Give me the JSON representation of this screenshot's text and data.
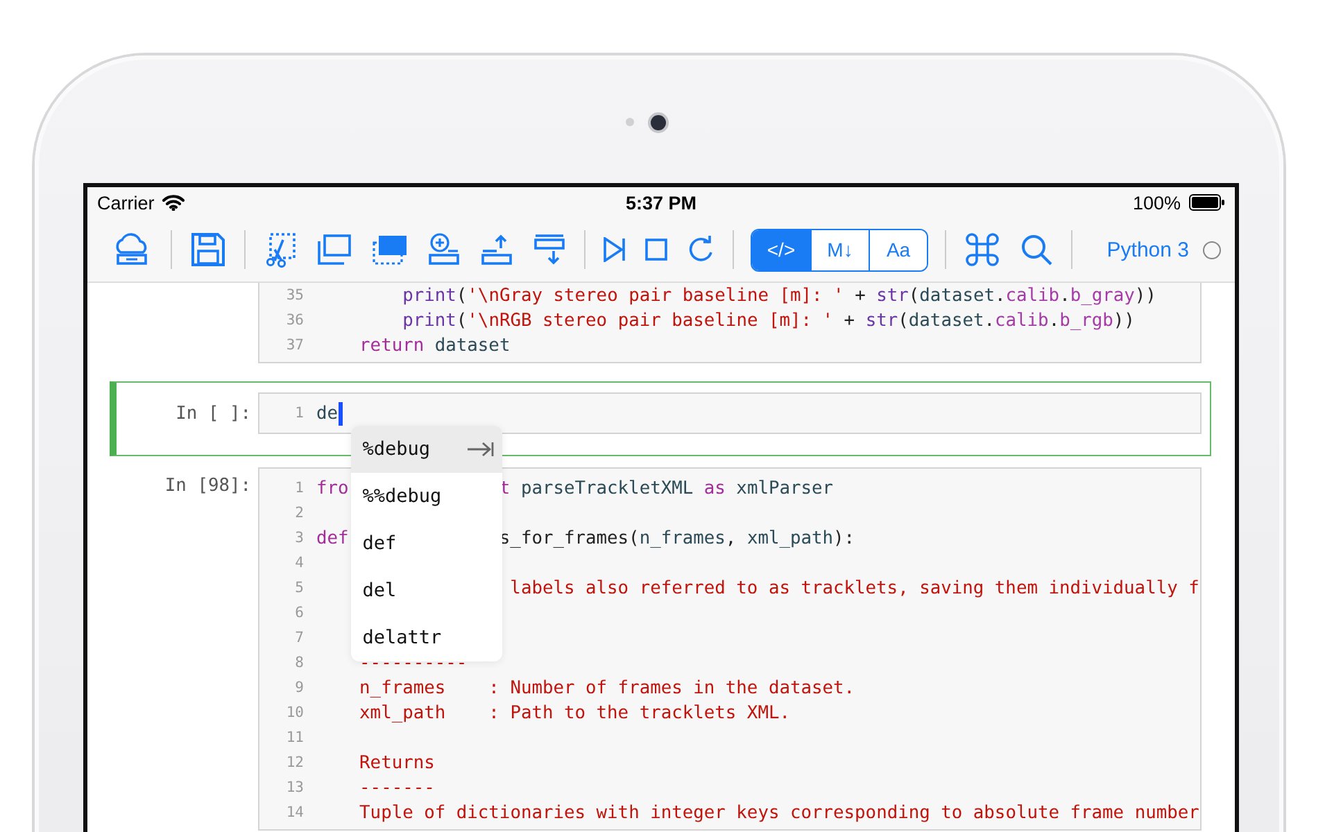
{
  "status_bar": {
    "carrier": "Carrier",
    "time": "5:37 PM",
    "battery": "100%"
  },
  "toolbar": {
    "modes": [
      {
        "label": "</>",
        "selected": true
      },
      {
        "label": "M↓",
        "selected": false
      },
      {
        "label": "Aa",
        "selected": false
      }
    ],
    "kernel": {
      "name": "Python 3",
      "busy": false
    }
  },
  "cells": [
    {
      "selected": false,
      "lines": [
        {
          "n": "35",
          "tokens": [
            {
              "t": "        print",
              "kind": "builtin"
            },
            {
              "t": "(",
              "kind": "plain"
            },
            {
              "t": "'\\nGray stereo pair baseline [m]: '",
              "kind": "str"
            },
            {
              "t": " + ",
              "kind": "plain"
            },
            {
              "t": "str",
              "kind": "builtin"
            },
            {
              "t": "(",
              "kind": "plain"
            },
            {
              "t": "dataset",
              "kind": "name"
            },
            {
              "t": ".",
              "kind": "plain"
            },
            {
              "t": "calib",
              "kind": "attr"
            },
            {
              "t": ".",
              "kind": "plain"
            },
            {
              "t": "b_gray",
              "kind": "attr"
            },
            {
              "t": "))",
              "kind": "plain"
            }
          ]
        },
        {
          "n": "36",
          "tokens": [
            {
              "t": "        print",
              "kind": "builtin"
            },
            {
              "t": "(",
              "kind": "plain"
            },
            {
              "t": "'\\nRGB stereo pair baseline [m]: '",
              "kind": "str"
            },
            {
              "t": " + ",
              "kind": "plain"
            },
            {
              "t": "str",
              "kind": "builtin"
            },
            {
              "t": "(",
              "kind": "plain"
            },
            {
              "t": "dataset",
              "kind": "name"
            },
            {
              "t": ".",
              "kind": "plain"
            },
            {
              "t": "calib",
              "kind": "attr"
            },
            {
              "t": ".",
              "kind": "plain"
            },
            {
              "t": "b_rgb",
              "kind": "attr"
            },
            {
              "t": "))",
              "kind": "plain"
            }
          ]
        },
        {
          "n": "37",
          "tokens": [
            {
              "t": "    return ",
              "kind": "kw"
            },
            {
              "t": "dataset",
              "kind": "name"
            }
          ]
        }
      ]
    },
    {
      "prompt": "In [ ]:",
      "selected": true,
      "cursor": true,
      "lines": [
        {
          "n": "1",
          "tokens": [
            {
              "t": "de",
              "kind": "name"
            }
          ]
        }
      ],
      "completions": [
        {
          "label": "%debug",
          "selected": true
        },
        {
          "label": "%%debug",
          "selected": false
        },
        {
          "label": "def",
          "selected": false
        },
        {
          "label": "del",
          "selected": false
        },
        {
          "label": "delattr",
          "selected": false
        }
      ]
    },
    {
      "prompt": "In [98]:",
      "selected": false,
      "lines": [
        {
          "n": "1",
          "tokens": [
            {
              "t": "fro",
              "kind": "kw"
            }
          ],
          "tokens_after_popup": [
            {
              "t": "t",
              "kind": "kw"
            },
            {
              "t": " parseTrackletXML ",
              "kind": "name"
            },
            {
              "t": "as",
              "kind": "kw"
            },
            {
              "t": " xmlParser",
              "kind": "name"
            }
          ]
        },
        {
          "n": "2"
        },
        {
          "n": "3",
          "tokens": [
            {
              "t": "def",
              "kind": "kw"
            }
          ],
          "tokens_after_popup": [
            {
              "t": "s_for_frames(",
              "kind": "plain"
            },
            {
              "t": "n_frames",
              "kind": "name"
            },
            {
              "t": ", ",
              "kind": "plain"
            },
            {
              "t": "xml_path",
              "kind": "name"
            },
            {
              "t": "):",
              "kind": "plain"
            }
          ]
        },
        {
          "n": "4"
        },
        {
          "n": "5",
          "tokens_after_popup": [
            {
              "t": " labels also referred to as tracklets, saving them individually f",
              "kind": "str"
            }
          ]
        },
        {
          "n": "6"
        },
        {
          "n": "7"
        },
        {
          "n": "8",
          "tokens": [
            {
              "t": "    ----------",
              "kind": "str"
            }
          ]
        },
        {
          "n": "9",
          "tokens": [
            {
              "t": "    n_frames    : Number of frames in the dataset.",
              "kind": "str"
            }
          ]
        },
        {
          "n": "10",
          "tokens": [
            {
              "t": "    xml_path    : Path to the tracklets XML.",
              "kind": "str"
            }
          ]
        },
        {
          "n": "11"
        },
        {
          "n": "12",
          "tokens": [
            {
              "t": "    Returns",
              "kind": "str"
            }
          ]
        },
        {
          "n": "13",
          "tokens": [
            {
              "t": "    -------",
              "kind": "str"
            }
          ]
        },
        {
          "n": "14",
          "tokens": [
            {
              "t": "    Tuple of dictionaries with integer keys corresponding to absolute frame number",
              "kind": "str"
            }
          ]
        }
      ]
    }
  ]
}
